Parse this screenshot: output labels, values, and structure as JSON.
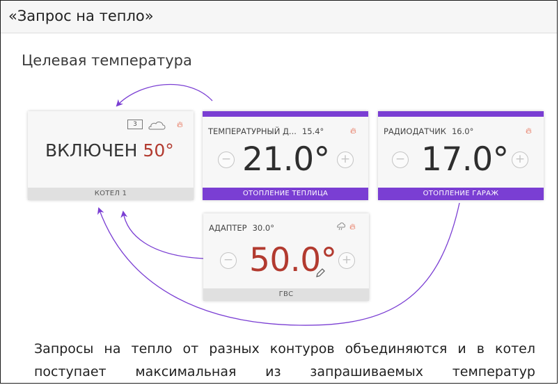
{
  "window": {
    "title": "«Запрос на тепло»"
  },
  "page": {
    "heading": "Целевая температура"
  },
  "boiler": {
    "status": "ВКЛЮЧЕН",
    "value": "50°",
    "footer": "КОТЕЛ 1",
    "badge_number": "3"
  },
  "cards": [
    {
      "sensor": "ТЕМПЕРАТУРНЫЙ Д...",
      "current": "15.4°",
      "target": "21.0°",
      "footer": "ОТОПЛЕНИЕ ТЕПЛИЦА"
    },
    {
      "sensor": "РАДИОДАТЧИК",
      "current": "16.0°",
      "target": "17.0°",
      "footer": "ОТОПЛЕНИЕ ГАРАЖ"
    },
    {
      "sensor": "АДАПТЕР",
      "current": "30.0°",
      "target": "50.0°",
      "footer": "ГВС"
    }
  ],
  "controls": {
    "minus": "−",
    "plus": "+"
  },
  "icons": {
    "flame": "flame-icon",
    "cloud": "cloud-icon",
    "weather": "weather-icon",
    "edit": "pencil-icon",
    "device": "device-icon"
  },
  "colors": {
    "accent": "#7a3ed3",
    "flame": "#e24b2b",
    "highlight_value": "#b23a2f"
  },
  "caption": "Запросы на тепло от разных контуров объединяются и в котел поступает максимальная из запрашиваемых температур"
}
